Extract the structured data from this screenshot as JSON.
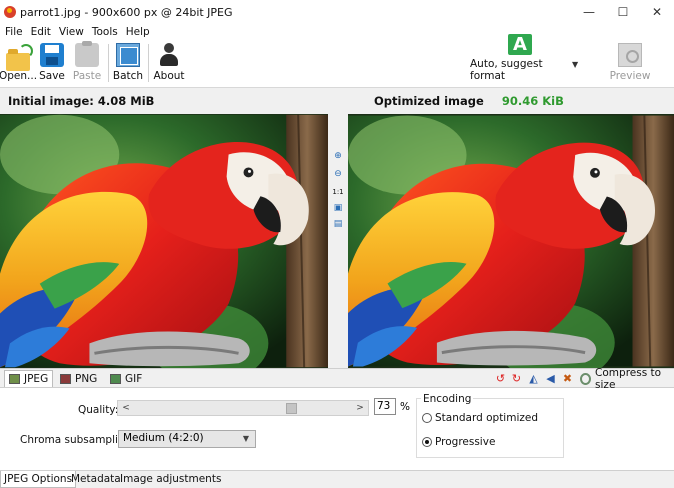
{
  "window": {
    "title": "parrot1.jpg - 900x600 px @ 24bit JPEG",
    "controls": [
      "—",
      "☐",
      "✕"
    ]
  },
  "menu": [
    "File",
    "Edit",
    "View",
    "Tools",
    "Help"
  ],
  "toolbar": {
    "open_label": "Open...",
    "save_label": "Save",
    "paste_label": "Paste",
    "batch_label": "Batch",
    "about_label": "About",
    "auto_icon_letter": "A",
    "auto_label": "Auto, suggest format",
    "auto_dropdown": "▼",
    "preview_label": "Preview"
  },
  "info": {
    "initial_label": "Initial image:",
    "initial_size": "4.08 MiB",
    "optimized_label": "Optimized image",
    "optimized_size": "90.46 KiB",
    "optimized_color": "#2f9a2f"
  },
  "zoom_controls": [
    "zoom-in",
    "zoom-out",
    "1:1",
    "fit",
    "split"
  ],
  "zoom_text": {
    "one_to_one": "1:1"
  },
  "formats": {
    "jpeg": "JPEG",
    "png": "PNG",
    "gif": "GIF",
    "compress_label": "Compress to size"
  },
  "options": {
    "quality_label": "Quality:",
    "quality_value": "73",
    "quality_unit": "%",
    "quality_level": 0.73,
    "slider_left": "<",
    "slider_right": ">",
    "chroma_label": "Chroma subsampling:",
    "chroma_value": "Medium (4:2:0)",
    "encoding_title": "Encoding",
    "encoding_standard": "Standard optimized",
    "encoding_progressive": "Progressive",
    "encoding_selected": "Progressive"
  },
  "bottom_tabs": [
    "JPEG Options",
    "Metadata",
    "Image adjustments"
  ]
}
